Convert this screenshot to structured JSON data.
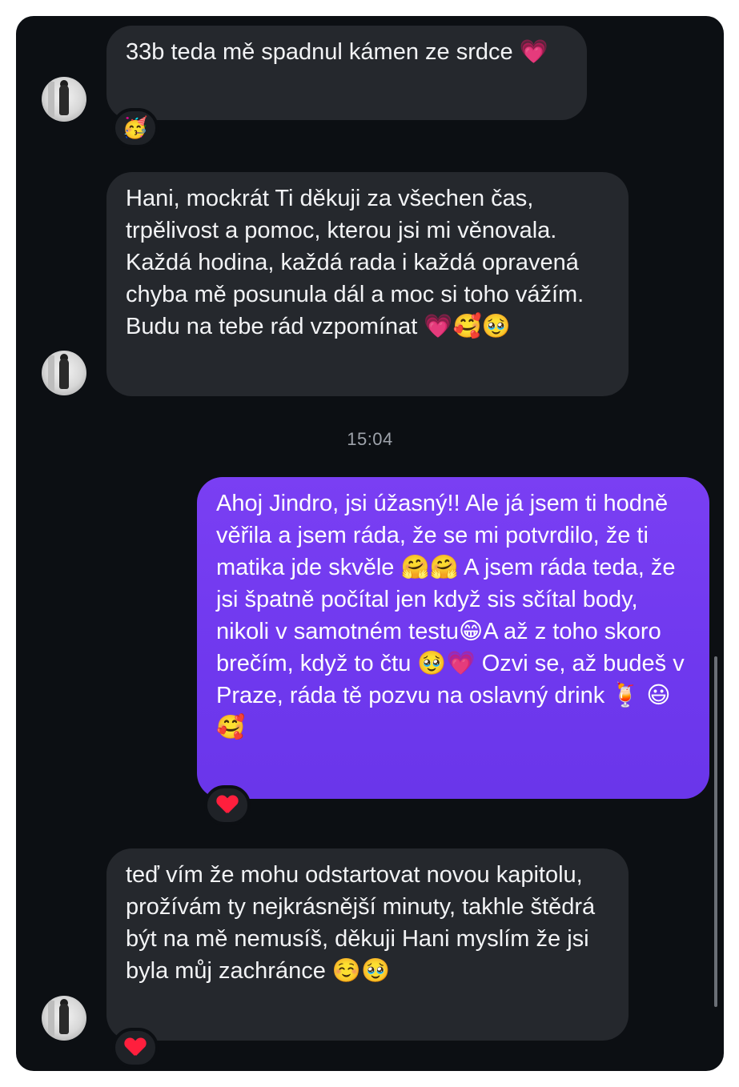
{
  "thread": {
    "messages": [
      {
        "text": "33b teda mě spadnul kámen ze srdce 💗",
        "reaction": "🥳"
      },
      {
        "text": "Hani, mockrát Ti děkuji za všechen čas, trpělivost a pomoc, kterou jsi mi věnovala. Každá hodina, každá rada i každá opravená chyba mě posunula dál a moc si toho vážím. Budu na tebe rád vzpomínat 💗🥰🥹"
      },
      {
        "timestamp": "15:04"
      },
      {
        "text": "Ahoj Jindro, jsi úžasný!! Ale já jsem ti hodně věřila a jsem ráda, že se mi potvrdilo, že ti matika jde skvěle  🤗🤗 A jsem ráda teda, že jsi špatně počítal jen když sis sčítal body, nikoli v samotném testu😁A až z toho skoro brečím, když to čtu 🥹💗 Ozvi se, až budeš v Praze, ráda tě pozvu na oslavný drink 🍹 😃🥰",
        "reaction": "heart"
      },
      {
        "text": "teď vím že mohu odstartovat novou kapitolu, prožívám ty nejkrásnější minuty, takhle štědrá být na mě nemusíš, děkuji Hani myslím že jsi byla můj zachránce ☺️🥹",
        "reaction": "heart"
      }
    ]
  }
}
